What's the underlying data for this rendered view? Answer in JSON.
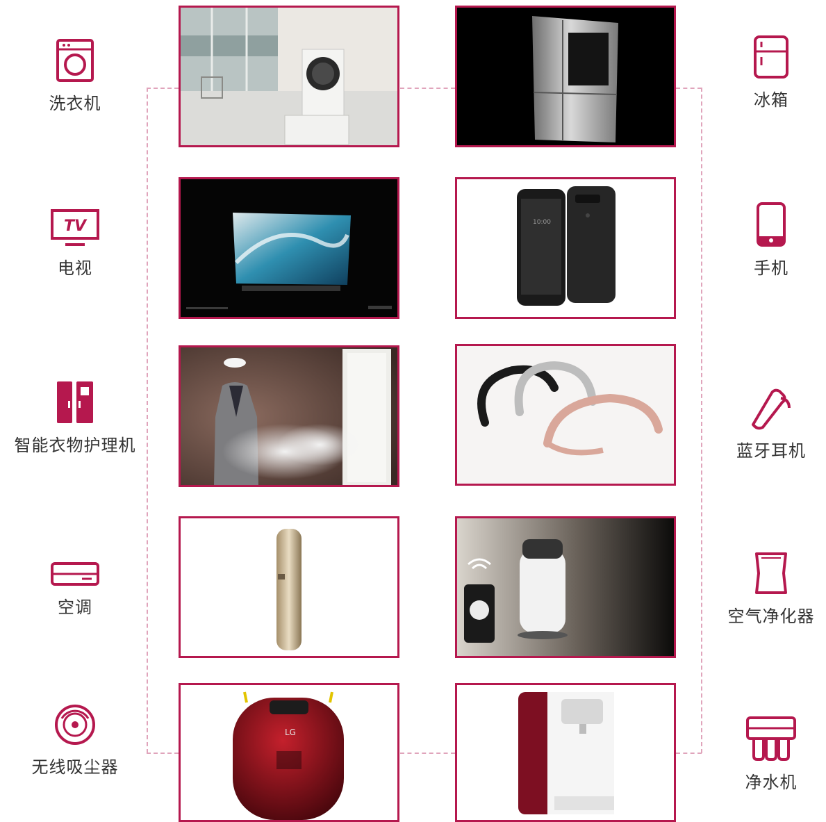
{
  "colors": {
    "accent": "#b5184e",
    "connector": "#e0a4bb",
    "text": "#333333"
  },
  "left_categories": [
    {
      "label": "洗衣机",
      "icon": "washing-machine-icon"
    },
    {
      "label": "电视",
      "icon": "tv-icon",
      "icon_text": "TV"
    },
    {
      "label": "智能衣物护理机",
      "icon": "clothing-care-icon"
    },
    {
      "label": "空调",
      "icon": "air-conditioner-icon"
    },
    {
      "label": "无线吸尘器",
      "icon": "robot-vacuum-icon"
    }
  ],
  "right_categories": [
    {
      "label": "冰箱",
      "icon": "refrigerator-icon"
    },
    {
      "label": "手机",
      "icon": "phone-icon"
    },
    {
      "label": "蓝牙耳机",
      "icon": "bluetooth-headset-icon"
    },
    {
      "label": "空气净化器",
      "icon": "air-purifier-icon"
    },
    {
      "label": "净水机",
      "icon": "water-purifier-icon"
    }
  ],
  "photos": {
    "left": [
      "washing-machine-photo",
      "oled-tv-photo",
      "styler-photo",
      "floor-ac-photo",
      "robot-vacuum-photo"
    ],
    "right": [
      "refrigerator-photo",
      "smartphone-photo",
      "neckband-headset-photo",
      "air-purifier-photo",
      "water-purifier-photo"
    ],
    "vacuum_brand": "LG"
  }
}
